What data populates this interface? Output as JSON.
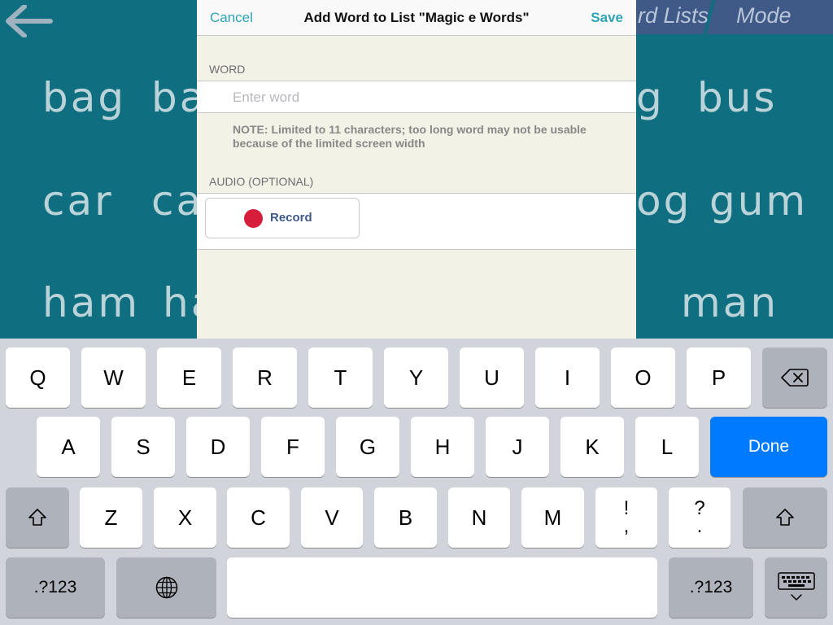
{
  "background": {
    "words": [
      {
        "id": "bag",
        "text": "bag"
      },
      {
        "id": "ba-partial",
        "text": "ba"
      },
      {
        "id": "g-partial",
        "text": "g"
      },
      {
        "id": "bus",
        "text": "bus"
      },
      {
        "id": "car",
        "text": "car"
      },
      {
        "id": "ca-partial",
        "text": "ca"
      },
      {
        "id": "og-partial",
        "text": "og"
      },
      {
        "id": "gum",
        "text": "gum"
      },
      {
        "id": "ham",
        "text": "ham"
      },
      {
        "id": "ha-partial",
        "text": "ha"
      },
      {
        "id": "man",
        "text": "man"
      }
    ],
    "tabs": {
      "lists_partial": "rd Lists",
      "mode": "Mode"
    },
    "colors": {
      "bg": "#0f6f80",
      "word": "#b9d3d8",
      "tab": "#3f5a86"
    }
  },
  "sheet": {
    "cancel": "Cancel",
    "title": "Add Word to List \"Magic e Words\"",
    "save": "Save",
    "word_header": "WORD",
    "word_placeholder": "Enter word",
    "word_value": "",
    "note": "NOTE: Limited to 11 characters; too long word may not be usable because of the limited screen width",
    "audio_header": "AUDIO (OPTIONAL)",
    "record_label": "Record",
    "colors": {
      "accent": "#2fa3b6",
      "record": "#d61d3c"
    }
  },
  "keyboard": {
    "row1": [
      "Q",
      "W",
      "E",
      "R",
      "T",
      "Y",
      "U",
      "I",
      "O",
      "P"
    ],
    "row2": [
      "A",
      "S",
      "D",
      "F",
      "G",
      "H",
      "J",
      "K",
      "L"
    ],
    "row3": [
      "Z",
      "X",
      "C",
      "V",
      "B",
      "N",
      "M"
    ],
    "punct1_top": "!",
    "punct1_bottom": ",",
    "punct2_top": "?",
    "punct2_bottom": ".",
    "done": "Done",
    "numbers_left": ".?123",
    "numbers_right": ".?123",
    "icons": {
      "backspace": "backspace-icon",
      "shift": "shift-icon",
      "globe": "globe-icon",
      "hide": "keyboard-hide-icon"
    },
    "colors": {
      "done": "#007aff"
    }
  }
}
